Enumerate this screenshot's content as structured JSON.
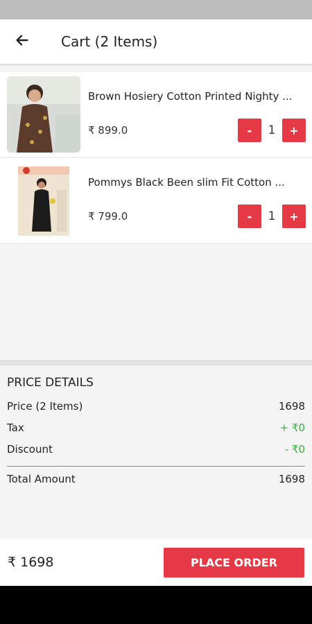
{
  "header": {
    "title": "Cart (2 Items)",
    "back_icon": "arrow-left-icon"
  },
  "cart": {
    "items": [
      {
        "title": "Brown Hosiery Cotton Printed Nighty ...",
        "price": "₹ 899.0",
        "qty": "1",
        "minus_label": "-",
        "plus_label": "+"
      },
      {
        "title": "Pommys Black Been slim Fit Cotton ...",
        "price": "₹ 799.0",
        "qty": "1",
        "minus_label": "-",
        "plus_label": "+"
      }
    ]
  },
  "price_details": {
    "title": "PRICE DETAILS",
    "price_label": "Price (2 Items)",
    "price_value": "1698",
    "tax_label": "Tax",
    "tax_value": "+ ₹0",
    "discount_label": "Discount",
    "discount_value": "- ₹0",
    "total_label": "Total Amount",
    "total_value": "1698"
  },
  "footer": {
    "total": "₹ 1698",
    "place_order_label": "PLACE ORDER"
  },
  "colors": {
    "accent": "#e63946",
    "positive": "#3cb043"
  }
}
